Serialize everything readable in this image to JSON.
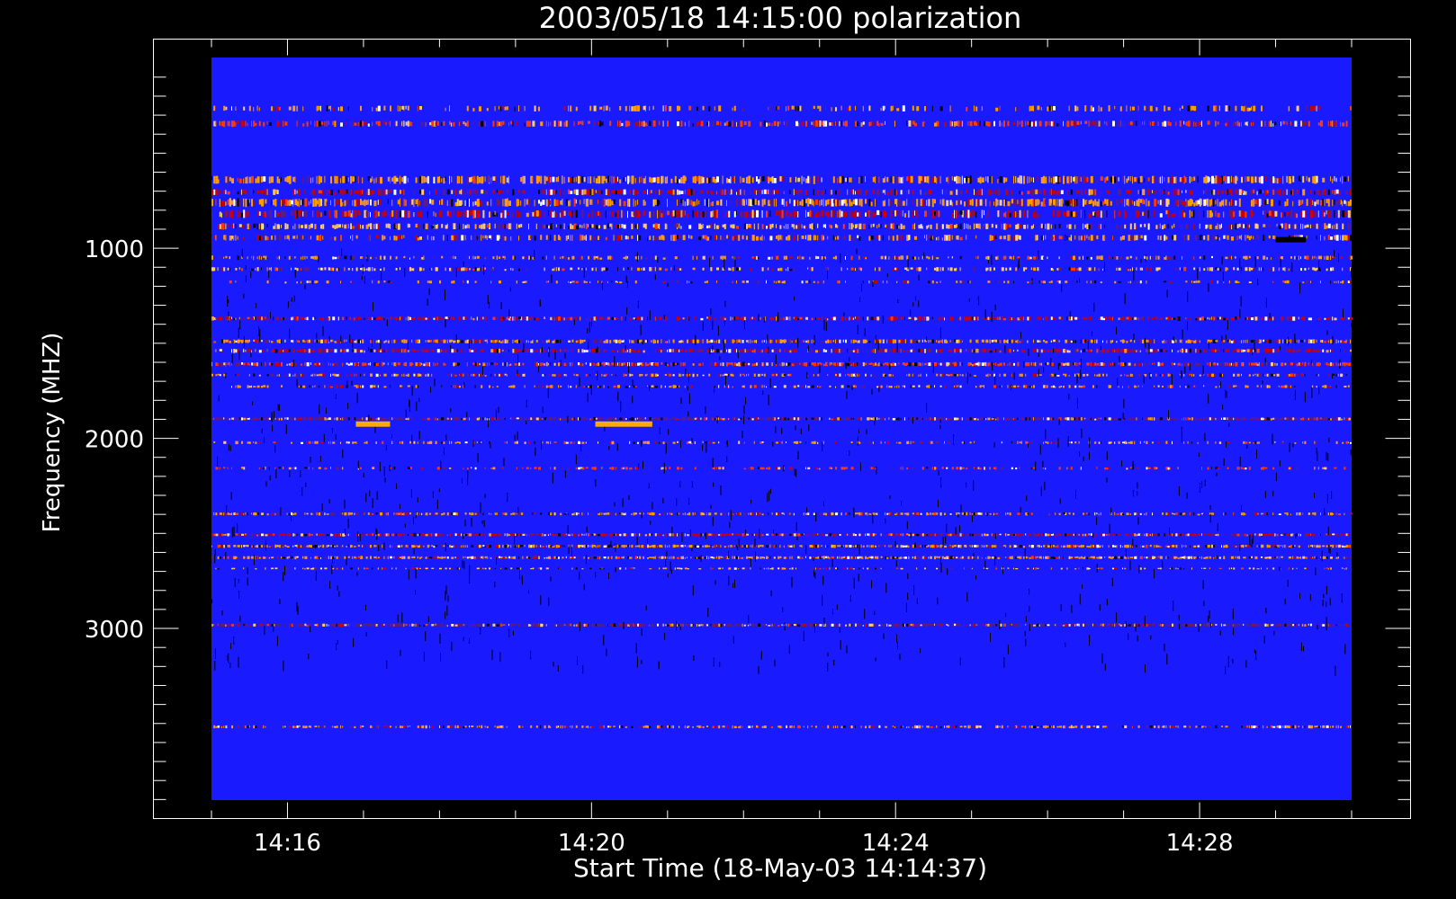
{
  "chart_data": {
    "type": "heatmap",
    "title": "2003/05/18 14:15:00 polarization",
    "xlabel": "Start Time (18-May-03 14:14:37)",
    "ylabel": "Frequency (MHZ)",
    "x_range": [
      "14:15:00",
      "14:30:00"
    ],
    "x_minutes_range": [
      15,
      30
    ],
    "x_ticks": [
      {
        "label": "14:16",
        "minute": 16
      },
      {
        "label": "14:20",
        "minute": 20
      },
      {
        "label": "14:24",
        "minute": 24
      },
      {
        "label": "14:28",
        "minute": 28
      }
    ],
    "x_minor_every_min": 1,
    "y_range": [
      100,
      4000
    ],
    "y_axis_range": [
      -100,
      4000
    ],
    "y_ticks": [
      {
        "label": "1000",
        "value": 1000
      },
      {
        "label": "2000",
        "value": 2000
      },
      {
        "label": "3000",
        "value": 3000
      }
    ],
    "y_minor_every_mhz": 100,
    "background_color": "#1a1aff",
    "value_colors": [
      "#000000",
      "#6a1a6a",
      "#cc0000",
      "#ff3a00",
      "#ff9a00",
      "#ffcc66",
      "#ffffff"
    ],
    "interference_bands": [
      {
        "from": 250,
        "to": 280,
        "density": 0.35,
        "color": "#ff9a00"
      },
      {
        "from": 330,
        "to": 360,
        "density": 0.6,
        "color": "#ff3a00"
      },
      {
        "from": 620,
        "to": 660,
        "density": 0.7,
        "color": "#ff9a00"
      },
      {
        "from": 690,
        "to": 720,
        "density": 0.6,
        "color": "#cc0000"
      },
      {
        "from": 740,
        "to": 780,
        "density": 0.7,
        "color": "#ff9a00"
      },
      {
        "from": 800,
        "to": 840,
        "density": 0.65,
        "color": "#cc0000"
      },
      {
        "from": 870,
        "to": 900,
        "density": 0.6,
        "color": "#ffcc66"
      },
      {
        "from": 930,
        "to": 960,
        "density": 0.5,
        "color": "#ff9a00"
      },
      {
        "from": 1040,
        "to": 1060,
        "density": 0.45,
        "color": "#ff9a00"
      },
      {
        "from": 1100,
        "to": 1120,
        "density": 0.45,
        "color": "#ffcc66"
      },
      {
        "from": 1170,
        "to": 1185,
        "density": 0.25,
        "color": "#ff9a00"
      },
      {
        "from": 1360,
        "to": 1380,
        "density": 0.7,
        "color": "#cc0000"
      },
      {
        "from": 1480,
        "to": 1500,
        "density": 0.75,
        "color": "#ff9a00"
      },
      {
        "from": 1530,
        "to": 1550,
        "density": 0.7,
        "color": "#cc0000"
      },
      {
        "from": 1600,
        "to": 1620,
        "density": 0.75,
        "color": "#ff3a00"
      },
      {
        "from": 1660,
        "to": 1675,
        "density": 0.5,
        "color": "#ff9a00"
      },
      {
        "from": 1720,
        "to": 1735,
        "density": 0.4,
        "color": "#ff9a00"
      },
      {
        "from": 1890,
        "to": 1905,
        "density": 0.95,
        "color": "#6a1a6a"
      },
      {
        "from": 2015,
        "to": 2030,
        "density": 0.35,
        "color": "#ff9a00"
      },
      {
        "from": 2150,
        "to": 2165,
        "density": 0.35,
        "color": "#ff3a00"
      },
      {
        "from": 2390,
        "to": 2405,
        "density": 0.6,
        "color": "#ff9a00"
      },
      {
        "from": 2500,
        "to": 2515,
        "density": 0.9,
        "color": "#cc0000"
      },
      {
        "from": 2560,
        "to": 2575,
        "density": 0.8,
        "color": "#ff9a00"
      },
      {
        "from": 2620,
        "to": 2635,
        "density": 0.8,
        "color": "#ff9a00"
      },
      {
        "from": 2680,
        "to": 2690,
        "density": 0.35,
        "color": "#ffcc66"
      },
      {
        "from": 2975,
        "to": 2990,
        "density": 0.85,
        "color": "#6a1a6a"
      },
      {
        "from": 3510,
        "to": 3525,
        "density": 0.6,
        "color": "#ff9a00"
      }
    ],
    "bright_patches": [
      {
        "freq": 1925,
        "from_minute": 16.9,
        "to_minute": 17.35,
        "color": "#ffaa00"
      },
      {
        "freq": 1925,
        "from_minute": 20.05,
        "to_minute": 20.8,
        "color": "#ffaa00"
      },
      {
        "freq": 955,
        "from_minute": 29.0,
        "to_minute": 29.4,
        "color": "#000000"
      }
    ]
  }
}
